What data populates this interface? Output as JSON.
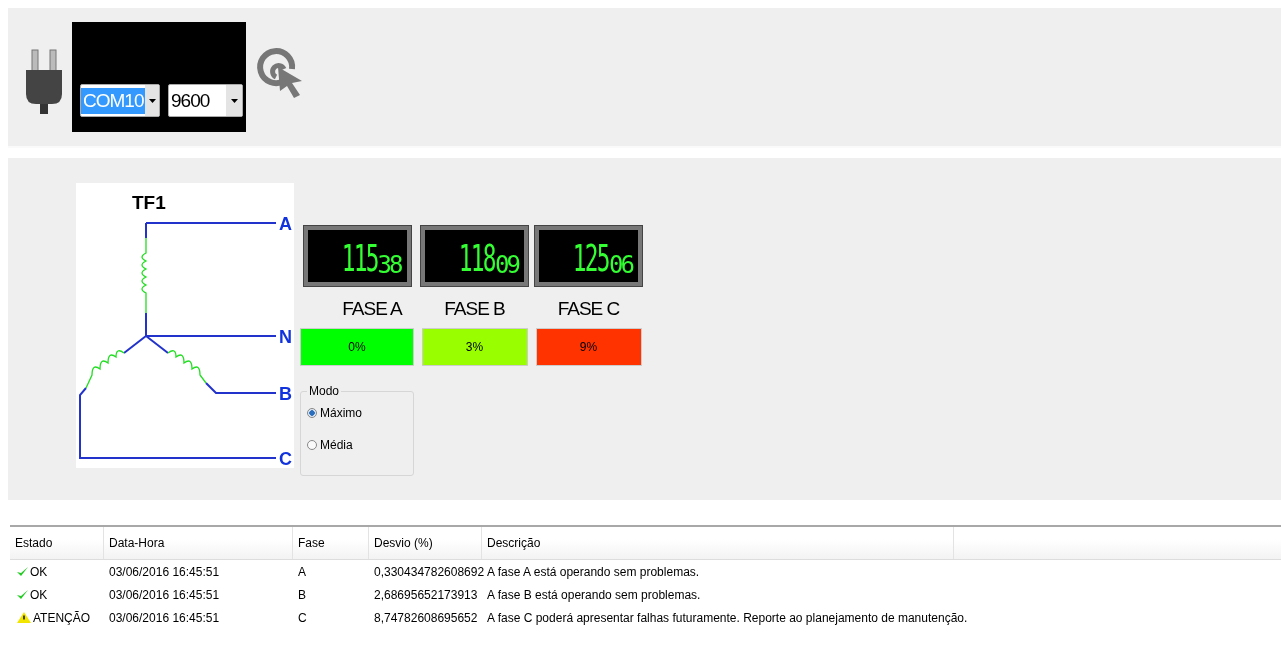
{
  "connection": {
    "port": {
      "value": "COM10",
      "selected": true
    },
    "baud": {
      "value": "9600"
    }
  },
  "transformer": {
    "title": "TF1",
    "terminals": [
      "A",
      "N",
      "B",
      "C"
    ]
  },
  "phases": [
    {
      "integer": "115",
      "fraction": "38",
      "label": "FASE A",
      "deviation": "0%",
      "color": "#00ff00"
    },
    {
      "integer": "118",
      "fraction": "09",
      "label": "FASE B",
      "deviation": "3%",
      "color": "#99ff00"
    },
    {
      "integer": "125",
      "fraction": "06",
      "label": "FASE C",
      "deviation": "9%",
      "color": "#ff3300"
    }
  ],
  "mode": {
    "title": "Modo",
    "options": [
      {
        "label": "Máximo",
        "selected": true
      },
      {
        "label": "Média",
        "selected": false
      }
    ]
  },
  "table": {
    "columns": [
      "Estado",
      "Data-Hora",
      "Fase",
      "Desvio (%)",
      "Descrição"
    ],
    "rows": [
      {
        "kind": "ok",
        "status": "OK",
        "datetime": "03/06/2016 16:45:51",
        "phase": "A",
        "deviation": "0,330434782608692",
        "description": "A fase A está operando sem problemas."
      },
      {
        "kind": "ok",
        "status": "OK",
        "datetime": "03/06/2016 16:45:51",
        "phase": "B",
        "deviation": "2,68695652173913",
        "description": "A fase B está operando sem problemas."
      },
      {
        "kind": "warning",
        "status": "ATENÇÃO",
        "datetime": "03/06/2016 16:45:51",
        "phase": "C",
        "deviation": "8,74782608695652",
        "description": "A fase C poderá apresentar falhas futuramente. Reporte ao planejamento de manutenção."
      }
    ]
  }
}
